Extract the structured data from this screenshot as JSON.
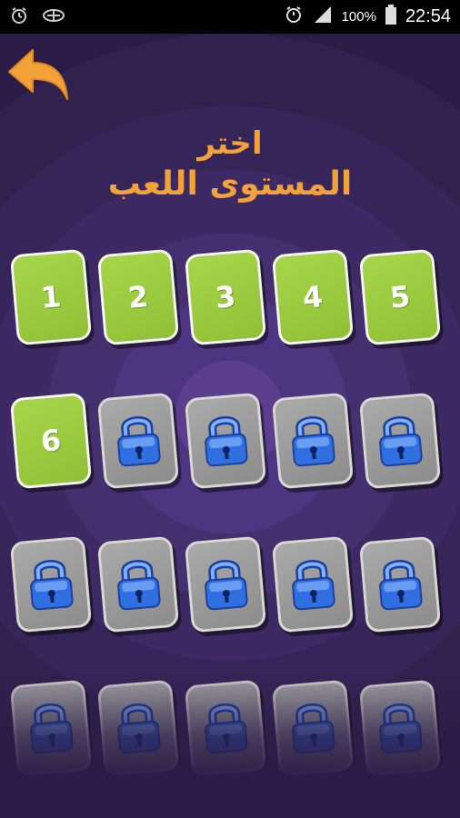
{
  "status_bar": {
    "battery_percent": "100%",
    "time": "22:54",
    "icons": [
      "alarm-clock-icon",
      "airplane-icon",
      "alarm-icon",
      "signal-icon",
      "battery-icon"
    ]
  },
  "header": {
    "back_icon": "back-arrow-icon",
    "title_line1": "اختر",
    "title_line2": "المستوى اللعب"
  },
  "colors": {
    "background": "#2c1e4e",
    "title": "#f3a23a",
    "unlocked_tile": "#9ccb3d",
    "locked_tile": "#9b9b9b",
    "lock": "#2f6fe0"
  },
  "levels": [
    {
      "label": "1",
      "locked": false
    },
    {
      "label": "2",
      "locked": false
    },
    {
      "label": "3",
      "locked": false
    },
    {
      "label": "4",
      "locked": false
    },
    {
      "label": "5",
      "locked": false
    },
    {
      "label": "6",
      "locked": false
    },
    {
      "label": "",
      "locked": true
    },
    {
      "label": "",
      "locked": true
    },
    {
      "label": "",
      "locked": true
    },
    {
      "label": "",
      "locked": true
    },
    {
      "label": "",
      "locked": true
    },
    {
      "label": "",
      "locked": true
    },
    {
      "label": "",
      "locked": true
    },
    {
      "label": "",
      "locked": true
    },
    {
      "label": "",
      "locked": true
    },
    {
      "label": "",
      "locked": true
    },
    {
      "label": "",
      "locked": true
    },
    {
      "label": "",
      "locked": true
    },
    {
      "label": "",
      "locked": true
    },
    {
      "label": "",
      "locked": true
    }
  ]
}
